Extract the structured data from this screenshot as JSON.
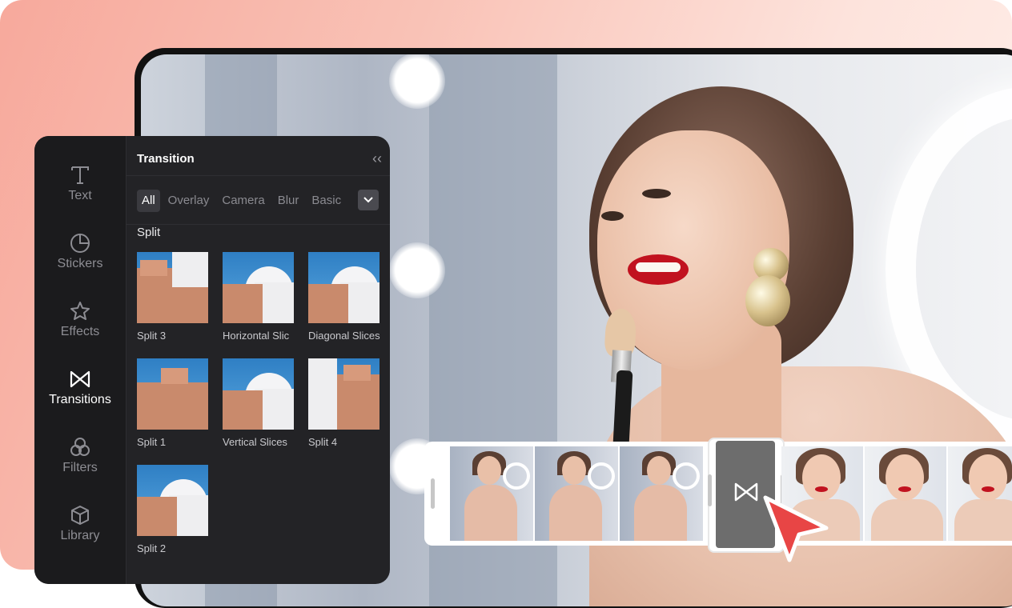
{
  "panel": {
    "rail": [
      {
        "label": "Text",
        "icon": "text-icon"
      },
      {
        "label": "Stickers",
        "icon": "sticker-icon"
      },
      {
        "label": "Effects",
        "icon": "effects-star-icon"
      },
      {
        "label": "Transitions",
        "icon": "transitions-bowtie-icon",
        "active": true
      },
      {
        "label": "Filters",
        "icon": "filters-icon"
      },
      {
        "label": "Library",
        "icon": "library-cube-icon"
      }
    ],
    "header": "Transition",
    "tabs": [
      "All",
      "Overlay",
      "Camera",
      "Blur",
      "Basic"
    ],
    "active_tab": "All",
    "section": "Split",
    "items": [
      {
        "label": "Split 3"
      },
      {
        "label": "Horizontal Slic"
      },
      {
        "label": "Diagonal Slices"
      },
      {
        "label": "Split 1"
      },
      {
        "label": "Vertical Slices"
      },
      {
        "label": "Split 4"
      },
      {
        "label": "Split 2"
      }
    ]
  },
  "colors": {
    "panel_bg": "#232326",
    "rail_bg": "#1b1b1d",
    "accent_red": "#e84545",
    "background_gradient": "#f7a99c"
  }
}
